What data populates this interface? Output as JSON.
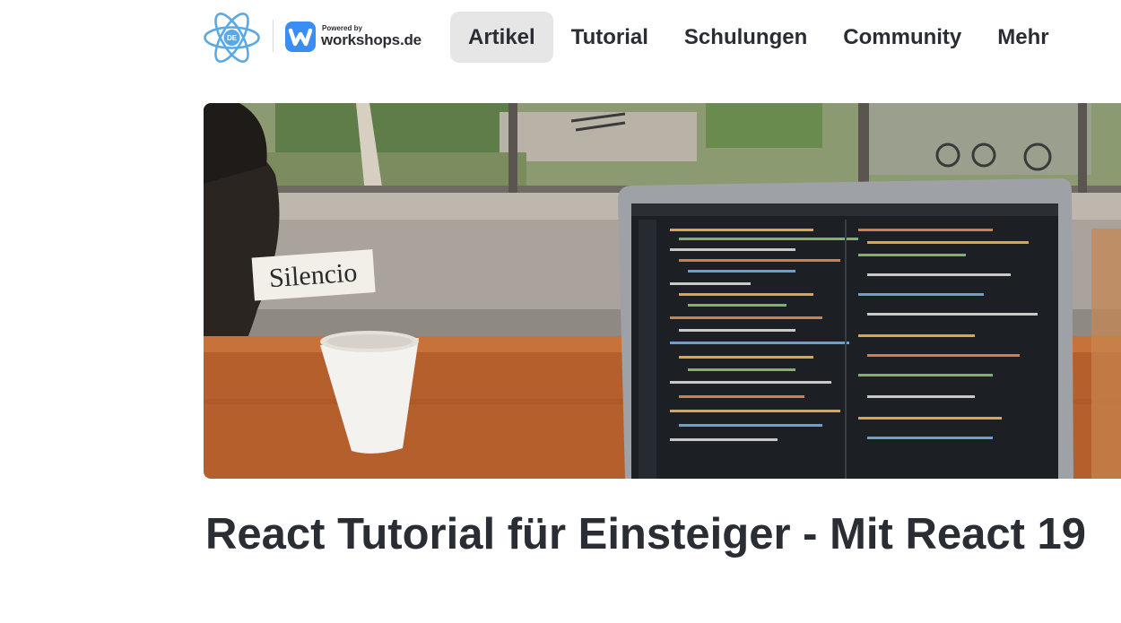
{
  "header": {
    "react_logo_badge": "DE",
    "powered_by": "Powered by",
    "brand": "workshops.de",
    "nav": [
      {
        "label": "Artikel",
        "active": true
      },
      {
        "label": "Tutorial",
        "active": false
      },
      {
        "label": "Schulungen",
        "active": false
      },
      {
        "label": "Community",
        "active": false
      },
      {
        "label": "Mehr",
        "active": false
      }
    ]
  },
  "hero": {
    "sign_text": "Silencio"
  },
  "article": {
    "title": "React Tutorial für Einsteiger - Mit React 19"
  },
  "colors": {
    "text": "#2a2d34",
    "nav_active_bg": "#e6e6e6",
    "react_blue": "#5aa9e6",
    "brand_blue": "#3a8df5"
  }
}
